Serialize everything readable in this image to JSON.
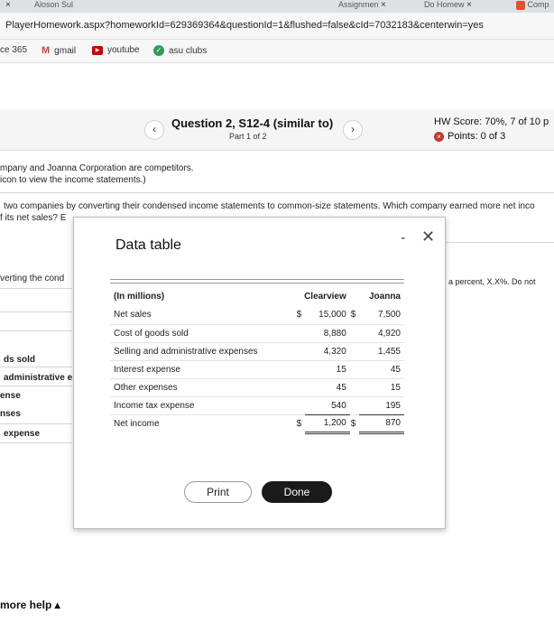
{
  "tabs": [
    {
      "label": "Aloson Sul",
      "close": "×"
    },
    {
      "label": "Assignmen",
      "close": "×"
    },
    {
      "label": "Do Homew",
      "close": "×"
    },
    {
      "label": "Comp",
      "close": ""
    }
  ],
  "address": {
    "url": "PlayerHomework.aspx?homeworkId=629369364&questionId=1&flushed=false&cId=7032183&centerwin=yes"
  },
  "bookmarks": [
    {
      "label": "ce 365",
      "icon": "office-icon",
      "color": "#999999"
    },
    {
      "label": "gmail",
      "icon": "gmail-icon",
      "color": "#d44638"
    },
    {
      "label": "youtube",
      "icon": "youtube-icon",
      "color": "#cc0000"
    },
    {
      "label": "asu clubs",
      "icon": "asu-icon",
      "color": "#2e9d57"
    }
  ],
  "header": {
    "prev": "‹",
    "next": "›",
    "title": "Question 2, S12-4 (similar to)",
    "part": "Part 1 of 2",
    "score": "HW Score: 70%, 7 of 10 p",
    "points": "Points: 0 of 3",
    "points_icon": "×"
  },
  "question": {
    "line1": "mpany and Joanna Corporation are competitors.",
    "line2": "icon to view the income statements.)",
    "line3": "two companies by converting their condensed income statements to common-size statements. Which company earned more net inco",
    "line4": "f its net sales? E",
    "left_label": "verting the cond",
    "right_label": "a percent, X.X%. Do not",
    "side_items": [
      "ds sold",
      "administrative e",
      "ense",
      "nses",
      "expense"
    ]
  },
  "modal": {
    "title": "Data table",
    "minimize": "-",
    "close": "✕",
    "header_label": "(In millions)",
    "col1": "Clearview",
    "col2": "Joanna",
    "rows": [
      {
        "label": "Net sales",
        "cur1": "$",
        "v1": "15,000",
        "cur2": "$",
        "v2": "7,500"
      },
      {
        "label": "Cost of goods sold",
        "cur1": "",
        "v1": "8,880",
        "cur2": "",
        "v2": "4,920"
      },
      {
        "label": "Selling and administrative expenses",
        "cur1": "",
        "v1": "4,320",
        "cur2": "",
        "v2": "1,455"
      },
      {
        "label": "Interest expense",
        "cur1": "",
        "v1": "15",
        "cur2": "",
        "v2": "45"
      },
      {
        "label": "Other expenses",
        "cur1": "",
        "v1": "45",
        "cur2": "",
        "v2": "15"
      },
      {
        "label": "Income tax expense",
        "cur1": "",
        "v1": "540",
        "cur2": "",
        "v2": "195"
      },
      {
        "label": "Net income",
        "cur1": "$",
        "v1": "1,200",
        "cur2": "$",
        "v2": "870"
      }
    ],
    "print_label": "Print",
    "done_label": "Done"
  },
  "footer": {
    "more_help": "more help ▴"
  }
}
